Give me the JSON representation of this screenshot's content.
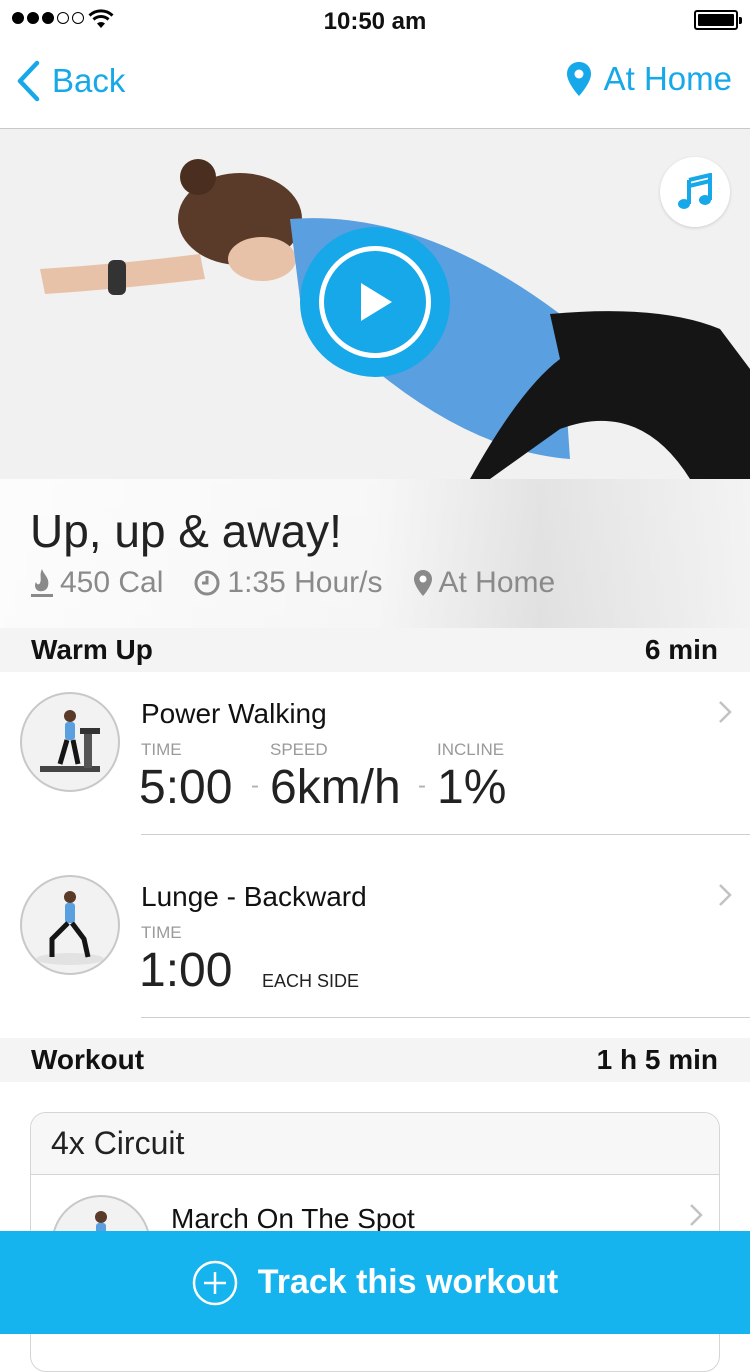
{
  "status_bar": {
    "time": "10:50 am"
  },
  "nav": {
    "back_label": "Back",
    "location_label": "At Home"
  },
  "hero": {
    "title": "Up, up & away!",
    "calories": "450 Cal",
    "duration": "1:35 Hour/s",
    "location": "At Home"
  },
  "sections": {
    "warmup": {
      "label": "Warm Up",
      "duration": "6 min"
    },
    "workout": {
      "label": "Workout",
      "duration": "1 h 5 min"
    }
  },
  "exercises": [
    {
      "name": "Power Walking",
      "time_label": "TIME",
      "time_value": "5:00",
      "speed_label": "SPEED",
      "speed_value": "6km/h",
      "incline_label": "INCLINE",
      "incline_value": "1%",
      "separator": "-"
    },
    {
      "name": "Lunge - Backward",
      "time_label": "TIME",
      "time_value": "1:00",
      "note": "EACH SIDE"
    }
  ],
  "circuit": {
    "title": "4x Circuit",
    "first_exercise": "March On The Spot"
  },
  "cta": {
    "label": "Track this workout"
  },
  "colors": {
    "accent": "#16a8e8",
    "cta": "#16b4ee"
  }
}
